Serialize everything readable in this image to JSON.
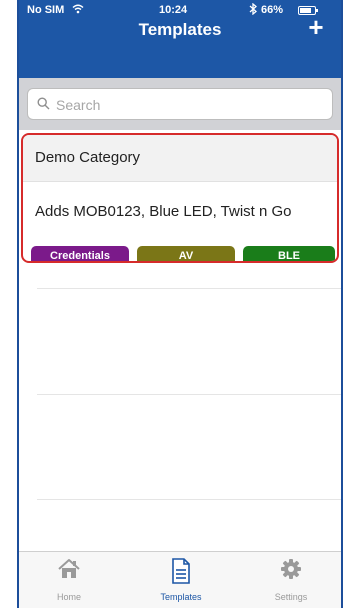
{
  "status_bar": {
    "carrier": "No SIM",
    "time": "10:24",
    "battery": "66%",
    "battery_level": 0.66
  },
  "nav": {
    "title": "Templates",
    "add_label": "+"
  },
  "search": {
    "placeholder": "Search",
    "value": ""
  },
  "template_card": {
    "category": "Demo Category",
    "description": "Adds MOB0123, Blue LED, Twist n Go",
    "tags": [
      {
        "label": "Credentials",
        "color": "#7b1a8a"
      },
      {
        "label": "AV",
        "color": "#7b7617"
      },
      {
        "label": "BLE",
        "color": "#1a7d1a"
      }
    ],
    "highlight_color": "#d62b2b"
  },
  "tabbar": {
    "items": [
      {
        "label": "Home",
        "icon": "home-icon",
        "active": false
      },
      {
        "label": "Templates",
        "icon": "document-icon",
        "active": true
      },
      {
        "label": "Settings",
        "icon": "gear-icon",
        "active": false
      }
    ]
  },
  "colors": {
    "brand": "#1d57a6",
    "inactive_tab": "#9a9a9a"
  }
}
